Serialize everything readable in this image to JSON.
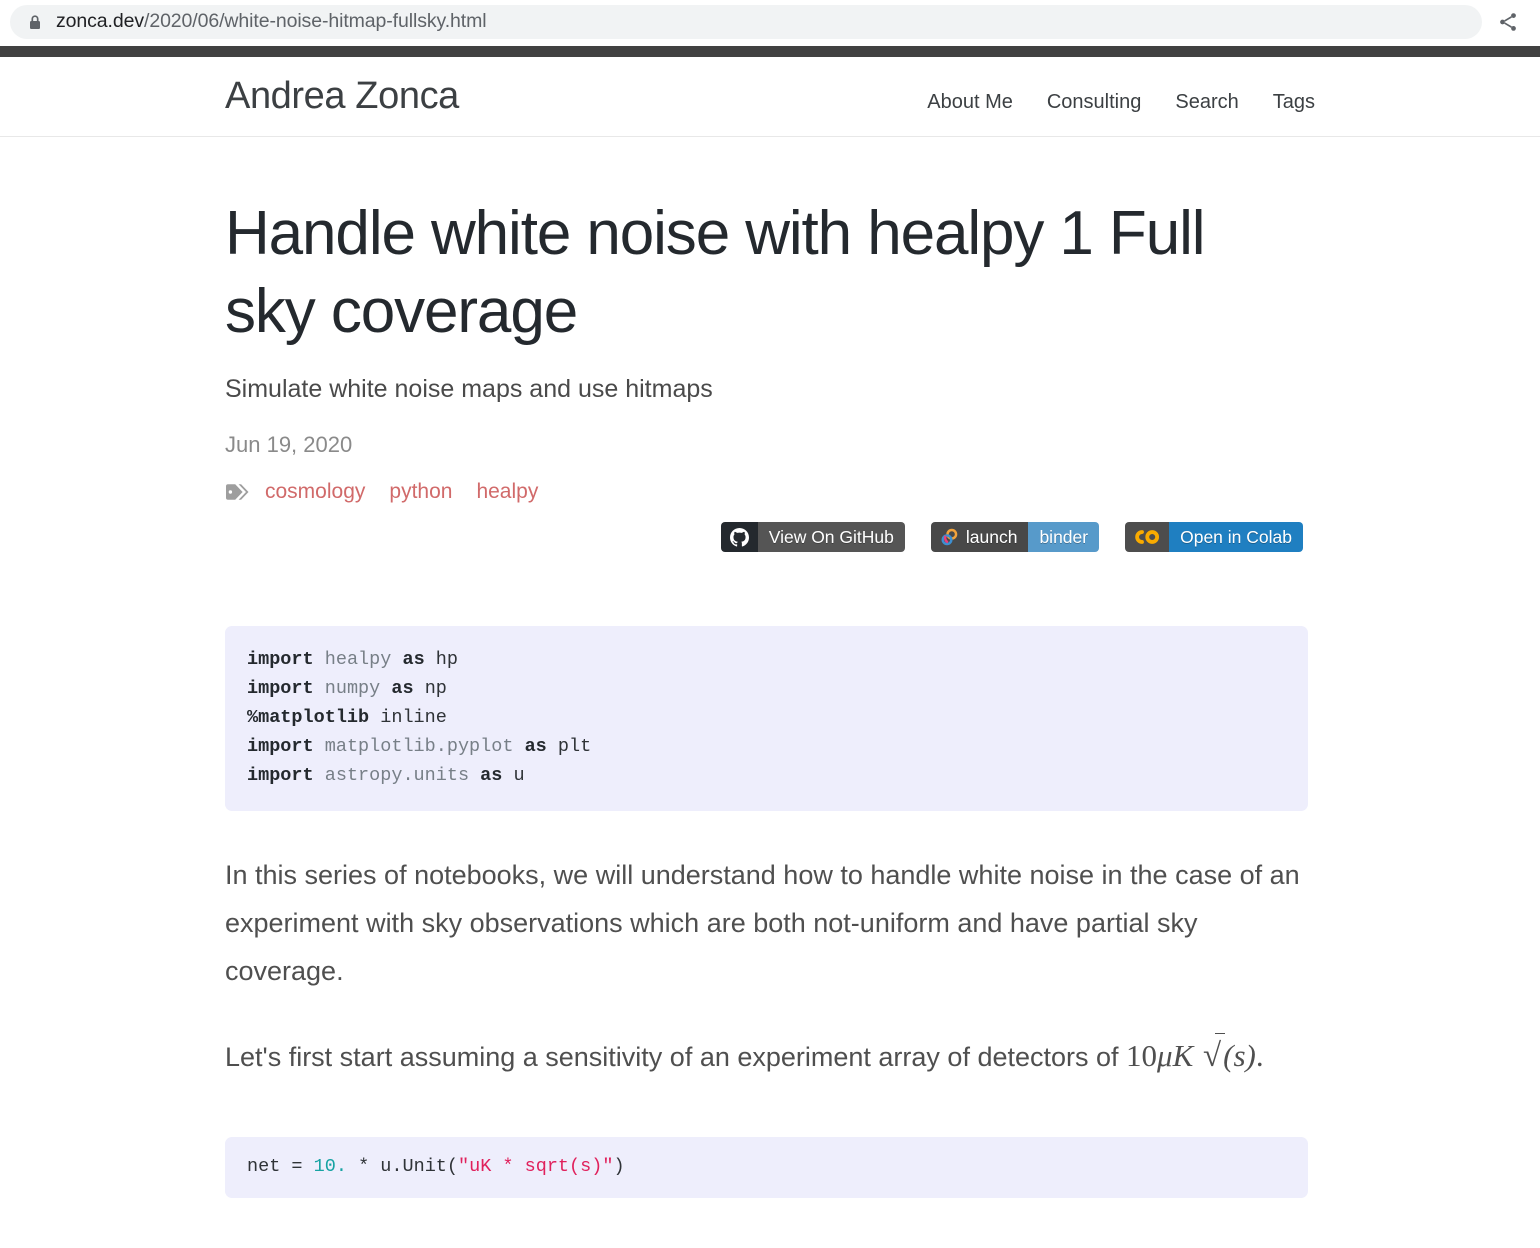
{
  "browser": {
    "url_host": "zonca.dev",
    "url_path": "/2020/06/white-noise-hitmap-fullsky.html",
    "lock_icon": "lock-icon",
    "share_icon": "share-icon"
  },
  "site_header": {
    "brand": "Andrea Zonca",
    "nav": [
      {
        "label": "About Me"
      },
      {
        "label": "Consulting"
      },
      {
        "label": "Search"
      },
      {
        "label": "Tags"
      }
    ]
  },
  "post": {
    "title": "Handle white noise with healpy 1 Full sky coverage",
    "subtitle": "Simulate white noise maps and use hitmaps",
    "date": "Jun 19, 2020",
    "tag_icon": "tag-icon",
    "tags": [
      {
        "label": "cosmology"
      },
      {
        "label": "python"
      },
      {
        "label": "healpy"
      }
    ]
  },
  "badges": [
    {
      "name": "view-on-github",
      "icon": "github-icon",
      "left_label": "",
      "right_label": "View On GitHub",
      "left_color": "#24292e",
      "right_color": "#555555"
    },
    {
      "name": "launch-binder",
      "icon": "binder-icon",
      "left_label": "launch",
      "right_label": "binder",
      "left_color": "#484848",
      "right_color": "#579aca"
    },
    {
      "name": "open-in-colab",
      "icon": "colab-icon",
      "left_label": "",
      "right_label": "Open in Colab",
      "left_color": "#4d4d4d",
      "right_color": "#1f7fc1"
    }
  ],
  "code_blocks": {
    "imports": {
      "line1_kw": "import",
      "line1_mod": "healpy",
      "line1_as": "as",
      "line1_alias": "hp",
      "line2_kw": "import",
      "line2_mod": "numpy",
      "line2_as": "as",
      "line2_alias": "np",
      "line3_magic": "%matplotlib",
      "line3_arg": "inline",
      "line4_kw": "import",
      "line4_mod": "matplotlib.pyplot",
      "line4_as": "as",
      "line4_alias": "plt",
      "line5_kw": "import",
      "line5_mod": "astropy.units",
      "line5_as": "as",
      "line5_alias": "u"
    },
    "net": {
      "var": "net",
      "eq": "=",
      "number": "10.",
      "star": "*",
      "call": "u.Unit(",
      "string": "\"uK * sqrt(s)\"",
      "close": ")"
    }
  },
  "paragraphs": {
    "p1": "In this series of notebooks, we will understand how to handle white noise in the case of an experiment with sky observations which are both not-uniform and have partial sky coverage.",
    "p2_lead": "Let's first start assuming a sensitivity of an experiment array of detectors of",
    "math_number": "10",
    "math_mu_k": "μK",
    "math_sqrt_arg": "(s)",
    "math_period": "."
  },
  "colors": {
    "accent_tag": "#d16a6a",
    "code_bg": "#eeeefc",
    "dark_strip": "#414141",
    "text": "#4f4f4f"
  }
}
